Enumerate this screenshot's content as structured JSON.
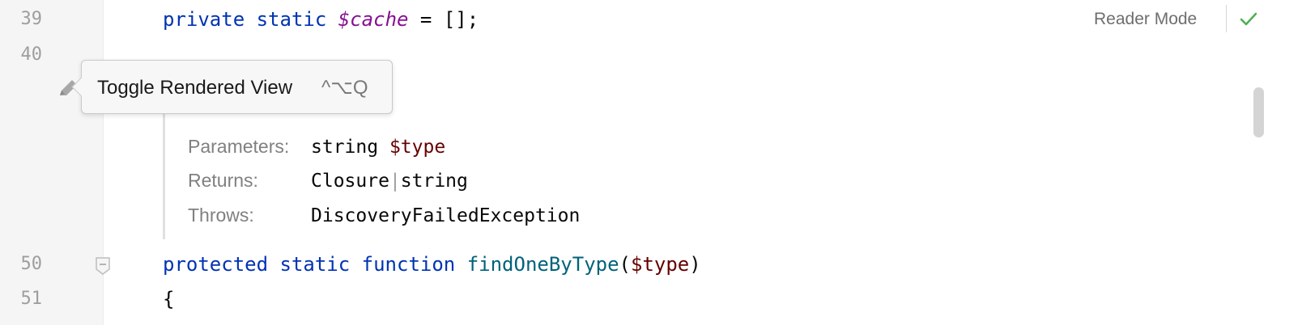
{
  "gutter": {
    "line_numbers": [
      "39",
      "40",
      "50",
      "51"
    ]
  },
  "code": {
    "line39": {
      "kw1": "private",
      "kw2": "static",
      "var": "$cache",
      "rest": " = [];"
    },
    "line50": {
      "kw1": "protected",
      "kw2": "static",
      "kw3": "function",
      "fn": "findOneByType",
      "open": "(",
      "param": "$type",
      "close": ")"
    },
    "line51": {
      "text": "{"
    }
  },
  "doc": {
    "parameters_label": "Parameters:",
    "parameters_type": "string",
    "parameters_name": "$type",
    "returns_label": "Returns:",
    "returns_type1": "Closure",
    "returns_sep": "|",
    "returns_type2": "string",
    "throws_label": "Throws:",
    "throws_value": "DiscoveryFailedException"
  },
  "tooltip": {
    "text": "Toggle Rendered View",
    "shortcut": "^⌥Q"
  },
  "toolbar": {
    "reader_mode": "Reader Mode"
  },
  "icons": {
    "pencil": "pencil-icon",
    "check": "check-icon",
    "fold": "fold-icon"
  },
  "colors": {
    "keyword": "#0033b3",
    "field": "#871094",
    "function": "#00627a",
    "parameter": "#660000",
    "check": "#4caf50"
  }
}
